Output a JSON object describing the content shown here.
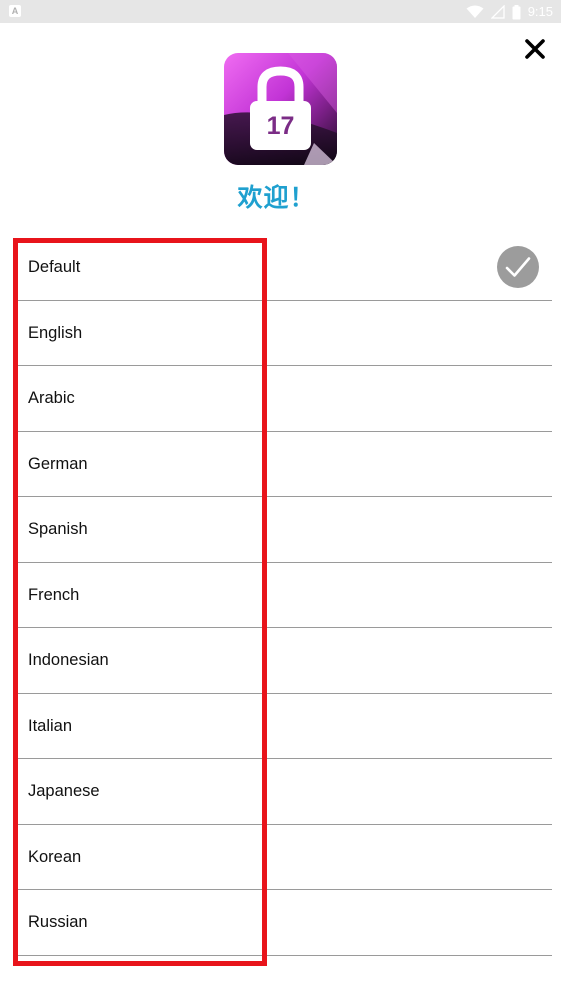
{
  "status_bar": {
    "left_icon": "A",
    "time": "9:15",
    "icons": [
      "wifi-icon",
      "signal-icon",
      "battery-icon"
    ]
  },
  "header": {
    "close_icon": "close-icon",
    "app_icon_number": "17",
    "welcome_text": "欢迎！"
  },
  "languages": [
    {
      "label": "Default",
      "selected": true
    },
    {
      "label": "English",
      "selected": false
    },
    {
      "label": "Arabic",
      "selected": false
    },
    {
      "label": "German",
      "selected": false
    },
    {
      "label": "Spanish",
      "selected": false
    },
    {
      "label": "French",
      "selected": false
    },
    {
      "label": "Indonesian",
      "selected": false
    },
    {
      "label": "Italian",
      "selected": false
    },
    {
      "label": "Japanese",
      "selected": false
    },
    {
      "label": "Korean",
      "selected": false
    },
    {
      "label": "Russian",
      "selected": false
    }
  ],
  "colors": {
    "welcome": "#1fa0cf",
    "highlight": "#e8141b",
    "check_badge": "#9c9c9c"
  }
}
